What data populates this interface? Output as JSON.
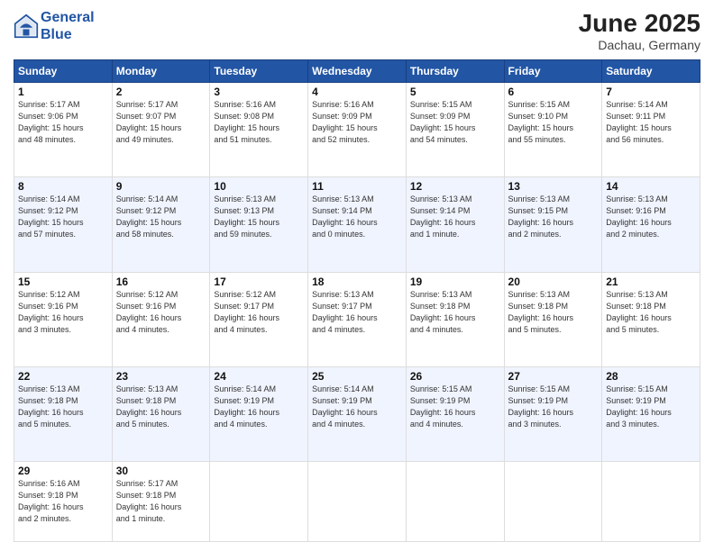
{
  "header": {
    "logo_line1": "General",
    "logo_line2": "Blue",
    "month": "June 2025",
    "location": "Dachau, Germany"
  },
  "weekdays": [
    "Sunday",
    "Monday",
    "Tuesday",
    "Wednesday",
    "Thursday",
    "Friday",
    "Saturday"
  ],
  "weeks": [
    [
      {
        "day": "1",
        "info": "Sunrise: 5:17 AM\nSunset: 9:06 PM\nDaylight: 15 hours\nand 48 minutes."
      },
      {
        "day": "2",
        "info": "Sunrise: 5:17 AM\nSunset: 9:07 PM\nDaylight: 15 hours\nand 49 minutes."
      },
      {
        "day": "3",
        "info": "Sunrise: 5:16 AM\nSunset: 9:08 PM\nDaylight: 15 hours\nand 51 minutes."
      },
      {
        "day": "4",
        "info": "Sunrise: 5:16 AM\nSunset: 9:09 PM\nDaylight: 15 hours\nand 52 minutes."
      },
      {
        "day": "5",
        "info": "Sunrise: 5:15 AM\nSunset: 9:09 PM\nDaylight: 15 hours\nand 54 minutes."
      },
      {
        "day": "6",
        "info": "Sunrise: 5:15 AM\nSunset: 9:10 PM\nDaylight: 15 hours\nand 55 minutes."
      },
      {
        "day": "7",
        "info": "Sunrise: 5:14 AM\nSunset: 9:11 PM\nDaylight: 15 hours\nand 56 minutes."
      }
    ],
    [
      {
        "day": "8",
        "info": "Sunrise: 5:14 AM\nSunset: 9:12 PM\nDaylight: 15 hours\nand 57 minutes."
      },
      {
        "day": "9",
        "info": "Sunrise: 5:14 AM\nSunset: 9:12 PM\nDaylight: 15 hours\nand 58 minutes."
      },
      {
        "day": "10",
        "info": "Sunrise: 5:13 AM\nSunset: 9:13 PM\nDaylight: 15 hours\nand 59 minutes."
      },
      {
        "day": "11",
        "info": "Sunrise: 5:13 AM\nSunset: 9:14 PM\nDaylight: 16 hours\nand 0 minutes."
      },
      {
        "day": "12",
        "info": "Sunrise: 5:13 AM\nSunset: 9:14 PM\nDaylight: 16 hours\nand 1 minute."
      },
      {
        "day": "13",
        "info": "Sunrise: 5:13 AM\nSunset: 9:15 PM\nDaylight: 16 hours\nand 2 minutes."
      },
      {
        "day": "14",
        "info": "Sunrise: 5:13 AM\nSunset: 9:16 PM\nDaylight: 16 hours\nand 2 minutes."
      }
    ],
    [
      {
        "day": "15",
        "info": "Sunrise: 5:12 AM\nSunset: 9:16 PM\nDaylight: 16 hours\nand 3 minutes."
      },
      {
        "day": "16",
        "info": "Sunrise: 5:12 AM\nSunset: 9:16 PM\nDaylight: 16 hours\nand 4 minutes."
      },
      {
        "day": "17",
        "info": "Sunrise: 5:12 AM\nSunset: 9:17 PM\nDaylight: 16 hours\nand 4 minutes."
      },
      {
        "day": "18",
        "info": "Sunrise: 5:13 AM\nSunset: 9:17 PM\nDaylight: 16 hours\nand 4 minutes."
      },
      {
        "day": "19",
        "info": "Sunrise: 5:13 AM\nSunset: 9:18 PM\nDaylight: 16 hours\nand 4 minutes."
      },
      {
        "day": "20",
        "info": "Sunrise: 5:13 AM\nSunset: 9:18 PM\nDaylight: 16 hours\nand 5 minutes."
      },
      {
        "day": "21",
        "info": "Sunrise: 5:13 AM\nSunset: 9:18 PM\nDaylight: 16 hours\nand 5 minutes."
      }
    ],
    [
      {
        "day": "22",
        "info": "Sunrise: 5:13 AM\nSunset: 9:18 PM\nDaylight: 16 hours\nand 5 minutes."
      },
      {
        "day": "23",
        "info": "Sunrise: 5:13 AM\nSunset: 9:18 PM\nDaylight: 16 hours\nand 5 minutes."
      },
      {
        "day": "24",
        "info": "Sunrise: 5:14 AM\nSunset: 9:19 PM\nDaylight: 16 hours\nand 4 minutes."
      },
      {
        "day": "25",
        "info": "Sunrise: 5:14 AM\nSunset: 9:19 PM\nDaylight: 16 hours\nand 4 minutes."
      },
      {
        "day": "26",
        "info": "Sunrise: 5:15 AM\nSunset: 9:19 PM\nDaylight: 16 hours\nand 4 minutes."
      },
      {
        "day": "27",
        "info": "Sunrise: 5:15 AM\nSunset: 9:19 PM\nDaylight: 16 hours\nand 3 minutes."
      },
      {
        "day": "28",
        "info": "Sunrise: 5:15 AM\nSunset: 9:19 PM\nDaylight: 16 hours\nand 3 minutes."
      }
    ],
    [
      {
        "day": "29",
        "info": "Sunrise: 5:16 AM\nSunset: 9:18 PM\nDaylight: 16 hours\nand 2 minutes."
      },
      {
        "day": "30",
        "info": "Sunrise: 5:17 AM\nSunset: 9:18 PM\nDaylight: 16 hours\nand 1 minute."
      },
      {
        "day": "",
        "info": ""
      },
      {
        "day": "",
        "info": ""
      },
      {
        "day": "",
        "info": ""
      },
      {
        "day": "",
        "info": ""
      },
      {
        "day": "",
        "info": ""
      }
    ]
  ]
}
